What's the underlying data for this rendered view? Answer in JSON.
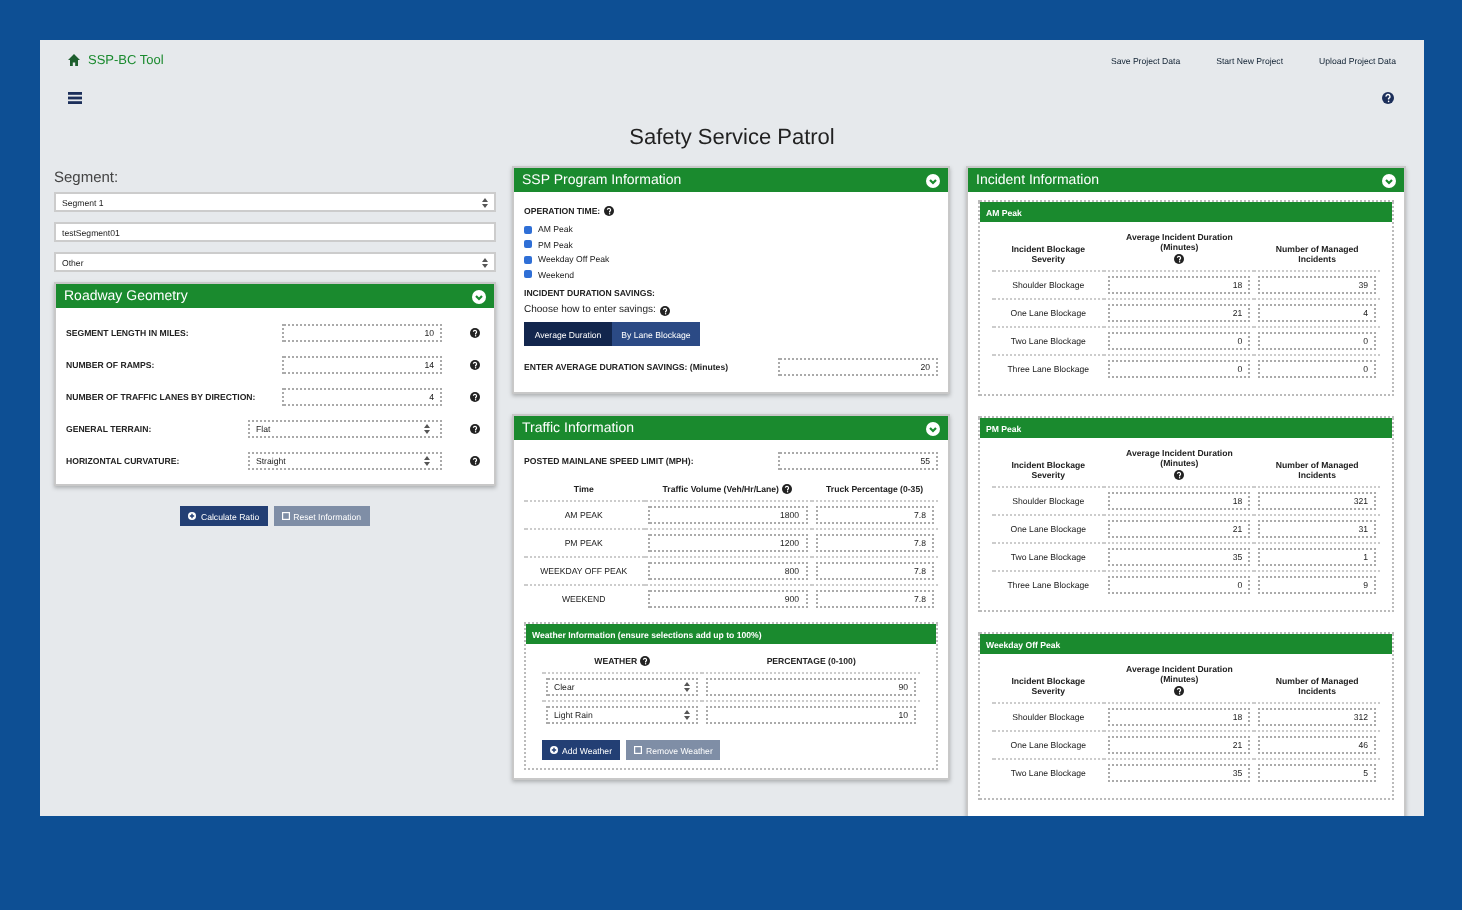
{
  "navbar": {
    "brand": "SSP-BC Tool",
    "links": [
      "Save Project Data",
      "Start New Project",
      "Upload Project Data"
    ]
  },
  "page_title": "Safety Service Patrol",
  "segment": {
    "label": "Segment:",
    "selector": "Segment 1",
    "name": "testSegment01",
    "type": "Other"
  },
  "roadway_geometry": {
    "title": "Roadway Geometry",
    "fields": [
      {
        "label": "SEGMENT LENGTH IN MILES:",
        "kind": "input",
        "value": "10"
      },
      {
        "label": "NUMBER OF RAMPS:",
        "kind": "input",
        "value": "14"
      },
      {
        "label": "NUMBER OF TRAFFIC LANES BY DIRECTION:",
        "kind": "input",
        "value": "4"
      },
      {
        "label": "GENERAL TERRAIN:",
        "kind": "select",
        "value": "Flat"
      },
      {
        "label": "HORIZONTAL CURVATURE:",
        "kind": "select",
        "value": "Straight"
      }
    ]
  },
  "buttons": [
    {
      "label": "Calculate Ratio",
      "kind": "primary"
    },
    {
      "label": "Reset Information",
      "kind": "secondary"
    }
  ],
  "ssp_program": {
    "title": "SSP Program Information",
    "operation_time_label": "OPERATION TIME:",
    "periods": [
      {
        "label": "AM Peak",
        "checked": true
      },
      {
        "label": "PM Peak",
        "checked": true
      },
      {
        "label": "Weekday Off Peak",
        "checked": true
      },
      {
        "label": "Weekend",
        "checked": true
      }
    ],
    "savings_label": "INCIDENT DURATION SAVINGS:",
    "savings_hint": "Choose how to enter savings:",
    "savings_modes": [
      {
        "label": "Average Duration",
        "selected": true
      },
      {
        "label": "By Lane Blockage",
        "selected": false
      }
    ],
    "average_label": "ENTER AVERAGE DURATION SAVINGS: (Minutes)",
    "average_value": "20"
  },
  "traffic": {
    "title": "Traffic Information",
    "speed_label": "POSTED MAINLANE SPEED LIMIT (MPH):",
    "speed_value": "55",
    "columns": [
      "Time",
      "Traffic Volume (Veh/Hr/Lane)",
      "Truck Percentage (0-35)"
    ],
    "rows": [
      {
        "time": "AM PEAK",
        "volume": "1800",
        "trucks": "7.8"
      },
      {
        "time": "PM PEAK",
        "volume": "1200",
        "trucks": "7.8"
      },
      {
        "time": "WEEKDAY OFF PEAK",
        "volume": "800",
        "trucks": "7.8"
      },
      {
        "time": "WEEKEND",
        "volume": "900",
        "trucks": "7.8"
      }
    ],
    "weather": {
      "title": "Weather Information (ensure selections add up to 100%)",
      "columns": [
        "WEATHER",
        "PERCENTAGE (0-100)"
      ],
      "rows": [
        {
          "weather": "Clear",
          "percentage": "90"
        },
        {
          "weather": "Light Rain",
          "percentage": "10"
        }
      ],
      "buttons": [
        {
          "label": "Add Weather",
          "kind": "primary"
        },
        {
          "label": "Remove Weather",
          "kind": "secondary"
        }
      ]
    }
  },
  "incident": {
    "title": "Incident Information",
    "periods": [
      {
        "title": "AM Peak",
        "columns": [
          "Incident Blockage Severity",
          "Average Incident Duration (Minutes)",
          "Number of Managed Incidents"
        ],
        "rows": [
          {
            "severity": "Shoulder Blockage",
            "duration": "18",
            "incidents": "39"
          },
          {
            "severity": "One Lane Blockage",
            "duration": "21",
            "incidents": "4"
          },
          {
            "severity": "Two Lane Blockage",
            "duration": "0",
            "incidents": "0"
          },
          {
            "severity": "Three Lane Blockage",
            "duration": "0",
            "incidents": "0"
          }
        ]
      },
      {
        "title": "PM Peak",
        "columns": [
          "Incident Blockage Severity",
          "Average Incident Duration (Minutes)",
          "Number of Managed Incidents"
        ],
        "rows": [
          {
            "severity": "Shoulder Blockage",
            "duration": "18",
            "incidents": "321"
          },
          {
            "severity": "One Lane Blockage",
            "duration": "21",
            "incidents": "31"
          },
          {
            "severity": "Two Lane Blockage",
            "duration": "35",
            "incidents": "1"
          },
          {
            "severity": "Three Lane Blockage",
            "duration": "0",
            "incidents": "9"
          }
        ]
      },
      {
        "title": "Weekday Off Peak",
        "columns": [
          "Incident Blockage Severity",
          "Average Incident Duration (Minutes)",
          "Number of Managed Incidents"
        ],
        "rows": [
          {
            "severity": "Shoulder Blockage",
            "duration": "18",
            "incidents": "312"
          },
          {
            "severity": "One Lane Blockage",
            "duration": "21",
            "incidents": "46"
          },
          {
            "severity": "Two Lane Blockage",
            "duration": "35",
            "incidents": "5"
          }
        ]
      }
    ]
  }
}
